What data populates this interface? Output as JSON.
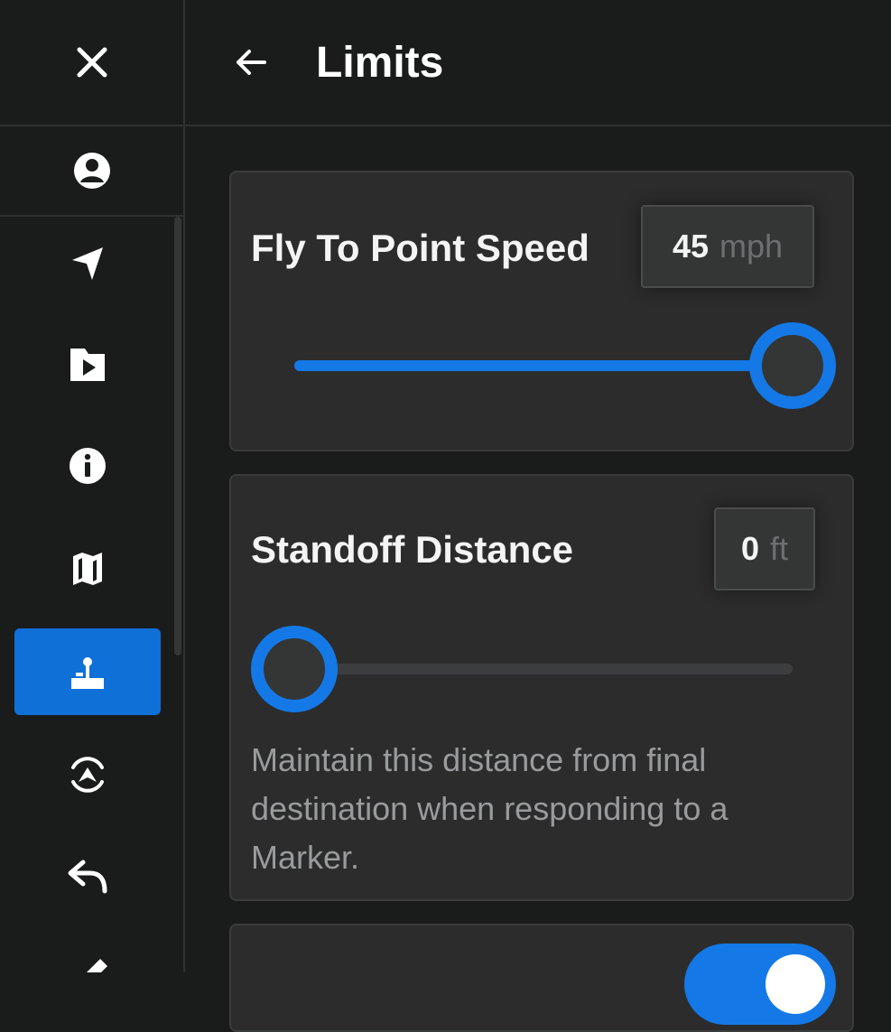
{
  "header": {
    "title": "Limits"
  },
  "sidebar": {
    "icons": [
      "close-icon",
      "account-icon",
      "navigation-icon",
      "media-icon",
      "info-icon",
      "map-icon",
      "joystick-icon",
      "orbit-icon",
      "return-icon",
      "edit-icon"
    ],
    "active_item": "joystick-icon"
  },
  "fly_to_point_speed": {
    "label": "Fly To Point Speed",
    "value": "45",
    "unit": "mph",
    "slider_fraction": 1.0
  },
  "standoff_distance": {
    "label": "Standoff Distance",
    "value": "0",
    "unit": "ft",
    "slider_fraction": 0.0,
    "description": "Maintain this distance from final destination when responding to a Marker."
  },
  "third_card": {
    "toggle_on": true
  },
  "colors": {
    "accent": "#1479e6",
    "active_bg": "#0f71d8",
    "background": "#1a1b1b",
    "card": "#2c2c2d"
  }
}
